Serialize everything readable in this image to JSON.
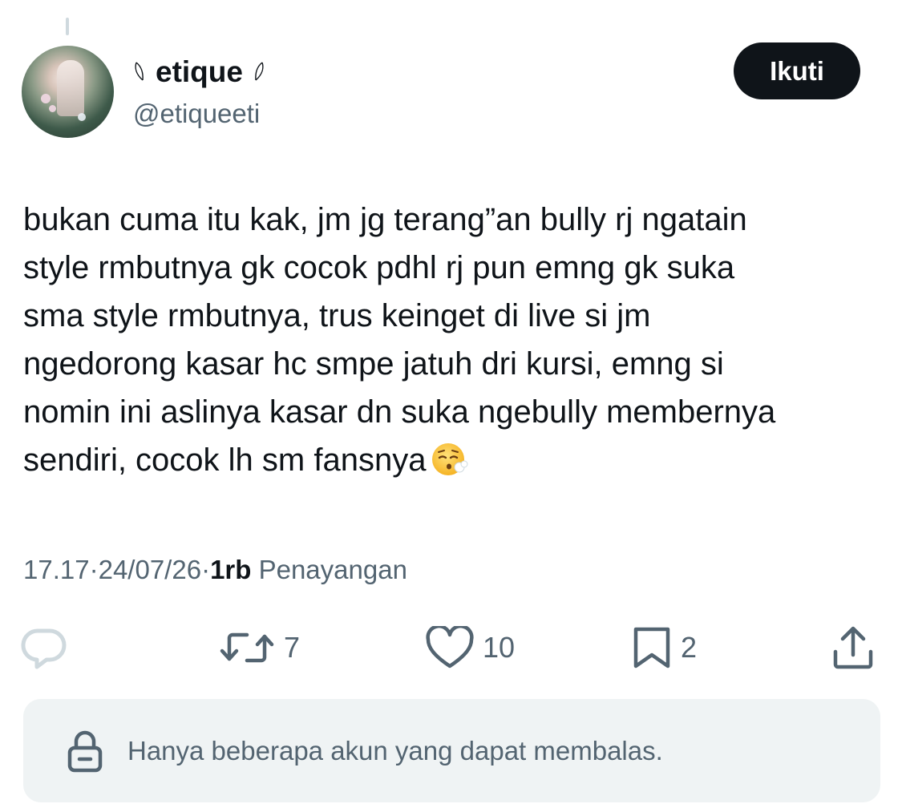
{
  "user": {
    "display_name": "etique",
    "handle": "@etiqueeti"
  },
  "follow_label": "Ikuti",
  "tweet": {
    "text": "bukan cuma itu kak, jm jg terang”an bully rj ngatain\nstyle rmbutnya gk cocok pdhl rj pun emng gk suka\nsma style rmbutnya, trus keinget di live si jm\nngedorong kasar hc smpe jatuh dri kursi, emng si\nnomin ini aslinya kasar dn suka ngebully membernya\nsendiri, cocok lh sm fansnya",
    "emoji": "face-exhaling-emoji"
  },
  "meta": {
    "time": "17.17",
    "separator": " · ",
    "date": "24/07/26",
    "views_count": "1rb",
    "views_label": " Penayangan"
  },
  "actions": {
    "reply_count": "",
    "repost_count": "7",
    "like_count": "10",
    "bookmark_count": "2"
  },
  "reply_restriction": {
    "text": "Hanya beberapa akun yang dapat membalas."
  },
  "colors": {
    "text_primary": "#0f1419",
    "text_secondary": "#536471",
    "follow_bg": "#0f1419",
    "restriction_bg": "#eff3f4",
    "reply_icon_disabled": "#cfd9de"
  },
  "icons": [
    "feather-icon",
    "reply-icon",
    "repost-icon",
    "heart-icon",
    "bookmark-icon",
    "share-icon",
    "lock-icon"
  ]
}
